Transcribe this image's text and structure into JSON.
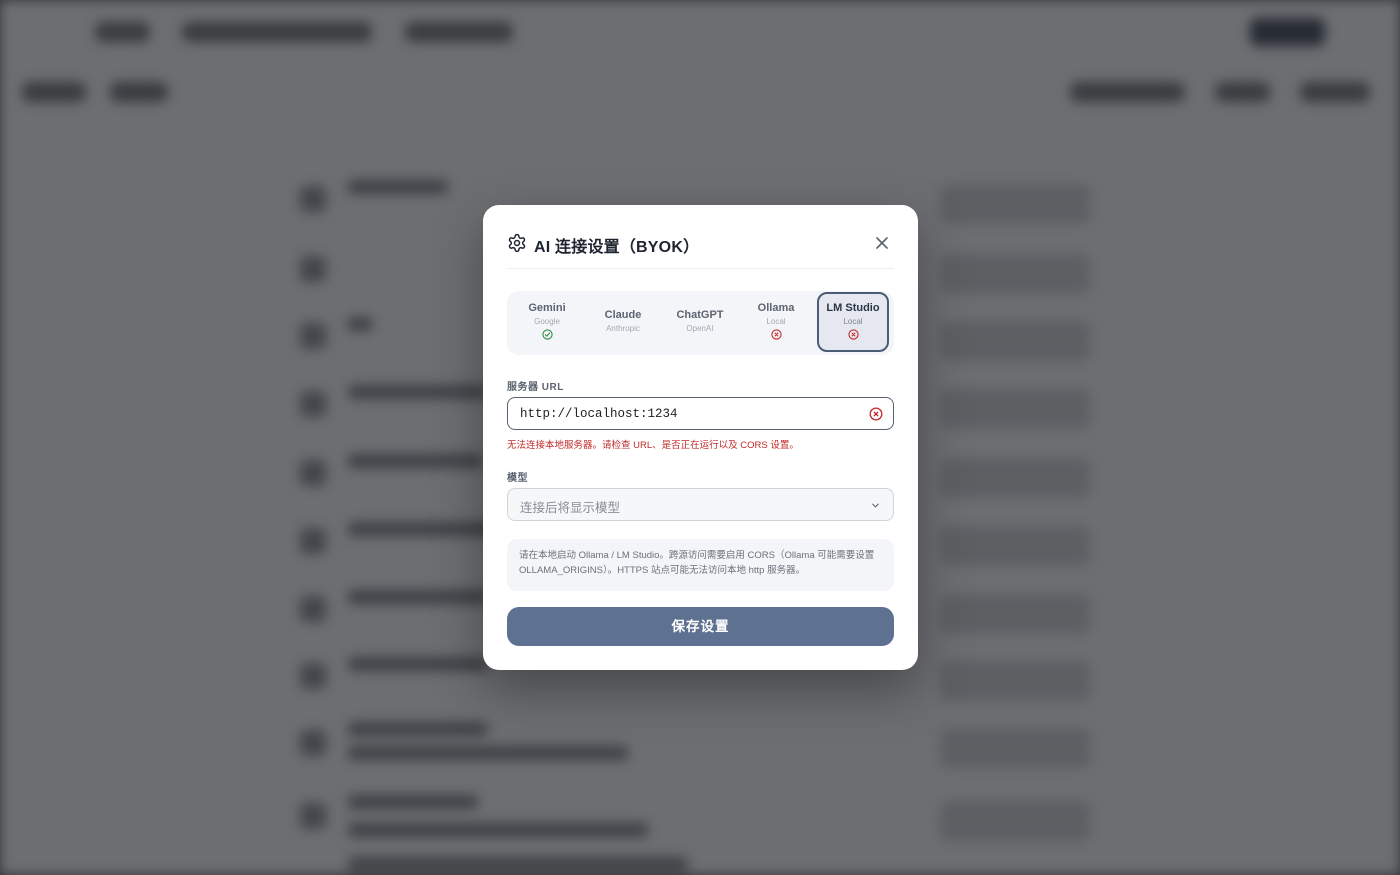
{
  "modal": {
    "title": "AI 连接设置（BYOK）",
    "close_icon": "close-icon",
    "providers": [
      {
        "name": "Gemini",
        "sub": "Google",
        "status": "connected"
      },
      {
        "name": "Claude",
        "sub": "Anthropic",
        "status": "none"
      },
      {
        "name": "ChatGPT",
        "sub": "OpenAI",
        "status": "none"
      },
      {
        "name": "Ollama",
        "sub": "Local",
        "status": "error"
      },
      {
        "name": "LM Studio",
        "sub": "Local",
        "status": "error",
        "selected": true
      }
    ],
    "url_label": "服务器 URL",
    "url_value": "http://localhost:1234",
    "url_error": "无法连接本地服务器。请检查 URL、是否正在运行以及 CORS 设置。",
    "model_label": "模型",
    "model_placeholder": "连接后将显示模型",
    "notice": "请在本地启动 Ollama / LM Studio。跨源访问需要启用 CORS（Ollama 可能需要设置 OLLAMA_ORIGINS）。HTTPS 站点可能无法访问本地 http 服务器。",
    "save_label": "保存设置"
  },
  "colors": {
    "accent": "#5f7190",
    "active_border": "#4c5b76",
    "success": "#2e8b3e",
    "error": "#c12a2a"
  }
}
